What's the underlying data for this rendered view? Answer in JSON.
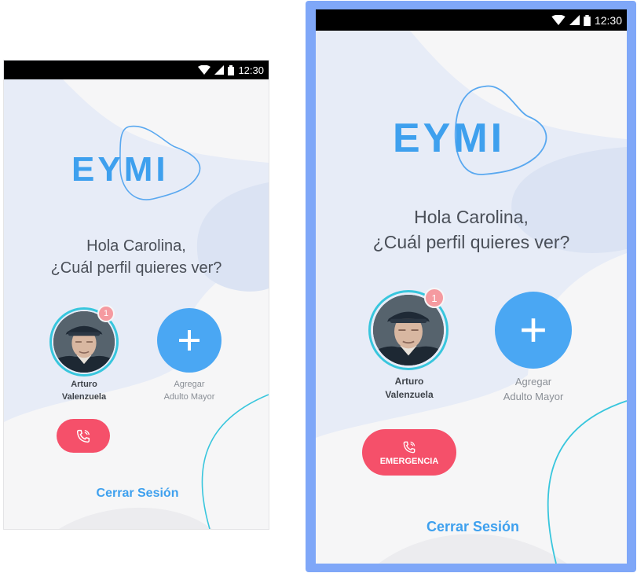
{
  "app": {
    "logo": "EYMI",
    "accent": "#3EA0EE",
    "emergency_color": "#F5506A"
  },
  "status_bar": {
    "time": "12:30",
    "icons": [
      "wifi-icon",
      "signal-icon",
      "battery-icon"
    ]
  },
  "greeting": {
    "line1": "Hola Carolina,",
    "line2": "¿Cuál perfil quieres ver?"
  },
  "profiles": [
    {
      "first_name": "Arturo",
      "last_name": "Valenzuela",
      "badge": "1"
    }
  ],
  "add_profile": {
    "line1": "Agregar",
    "line2": "Adulto Mayor"
  },
  "emergency": {
    "label": "EMERGENCIA",
    "icon": "phone-ringing-icon"
  },
  "logout": {
    "label": "Cerrar Sesión"
  }
}
